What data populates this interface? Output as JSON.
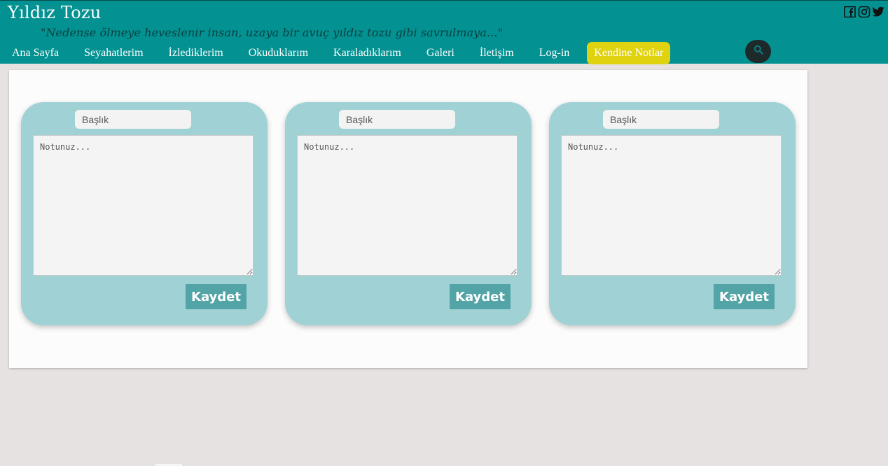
{
  "header": {
    "site_title": "Yıldız Tozu",
    "tagline": "\"Nedense ölmeye heveslenir insan, uzaya bir avuç yıldız tozu gibi savrulmaya...\"",
    "social_icons": [
      "facebook-icon",
      "instagram-icon",
      "twitter-icon"
    ]
  },
  "nav": {
    "items": [
      {
        "label": "Ana Sayfa"
      },
      {
        "label": "Seyahatlerim"
      },
      {
        "label": "İzlediklerim"
      },
      {
        "label": "Okuduklarım"
      },
      {
        "label": "Karaladıklarım"
      },
      {
        "label": "Galeri"
      },
      {
        "label": "İletişim"
      },
      {
        "label": "Log-in"
      },
      {
        "label": "Kendine Notlar",
        "active": true
      }
    ],
    "search_icon": "search-icon"
  },
  "notes": [
    {
      "title_placeholder": "Başlık",
      "body_placeholder": "Notunuz...",
      "save_label": "Kaydet"
    },
    {
      "title_placeholder": "Başlık",
      "body_placeholder": "Notunuz...",
      "save_label": "Kaydet"
    },
    {
      "title_placeholder": "Başlık",
      "body_placeholder": "Notunuz...",
      "save_label": "Kaydet"
    }
  ],
  "colors": {
    "header_bg": "#039192",
    "active_nav": "#dfd20f",
    "note_bg": "#a0d2d5",
    "button_bg": "#53a4a6",
    "page_bg": "#e6e2e1"
  }
}
